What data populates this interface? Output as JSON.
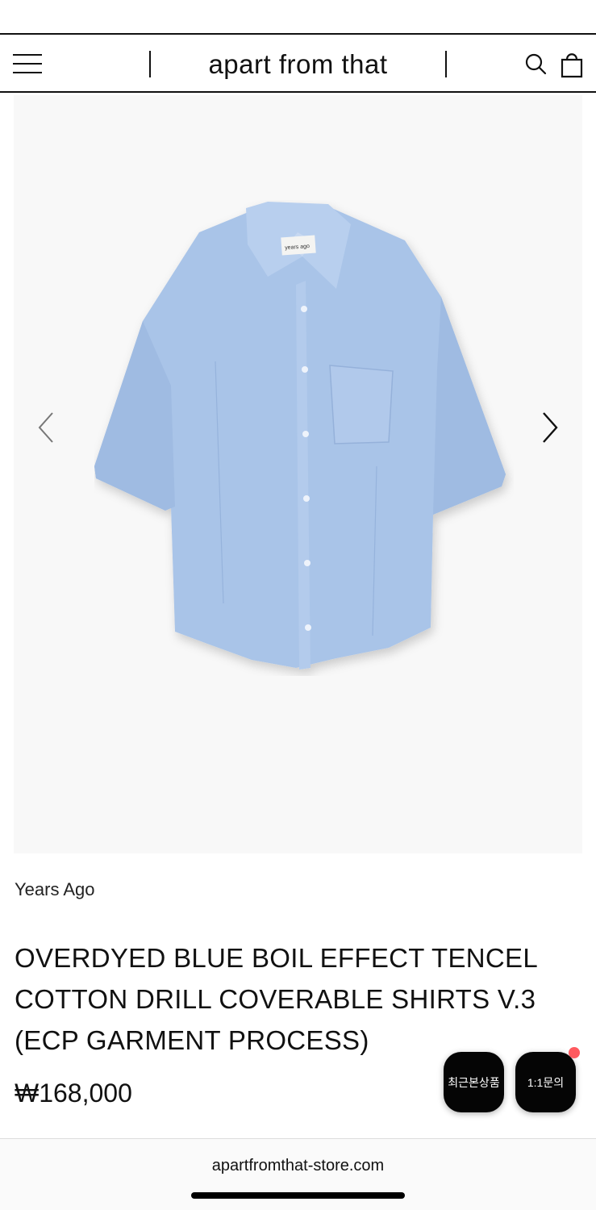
{
  "header": {
    "logo": "apart from that",
    "icons": [
      "menu-icon",
      "search-icon",
      "shopping-bag-icon"
    ]
  },
  "gallery": {
    "image_label": "years ago",
    "prev_icon": "chevron-left-icon",
    "next_icon": "chevron-right-icon"
  },
  "product": {
    "brand": "Years Ago",
    "title": "OVERDYED BLUE BOIL EFFECT TENCEL COTTON DRILL COVERABLE SHIRTS V.3 (ECP GARMENT PROCESS)",
    "price": "₩168,000"
  },
  "floating": {
    "recent_label": "최근본상품",
    "inquiry_label": "1:1문의",
    "notification_color": "#ff5a5f"
  },
  "browser": {
    "url": "apartfromthat-store.com"
  },
  "colors": {
    "shirt": "#a9c4e8",
    "background": "#f8f8f8"
  }
}
